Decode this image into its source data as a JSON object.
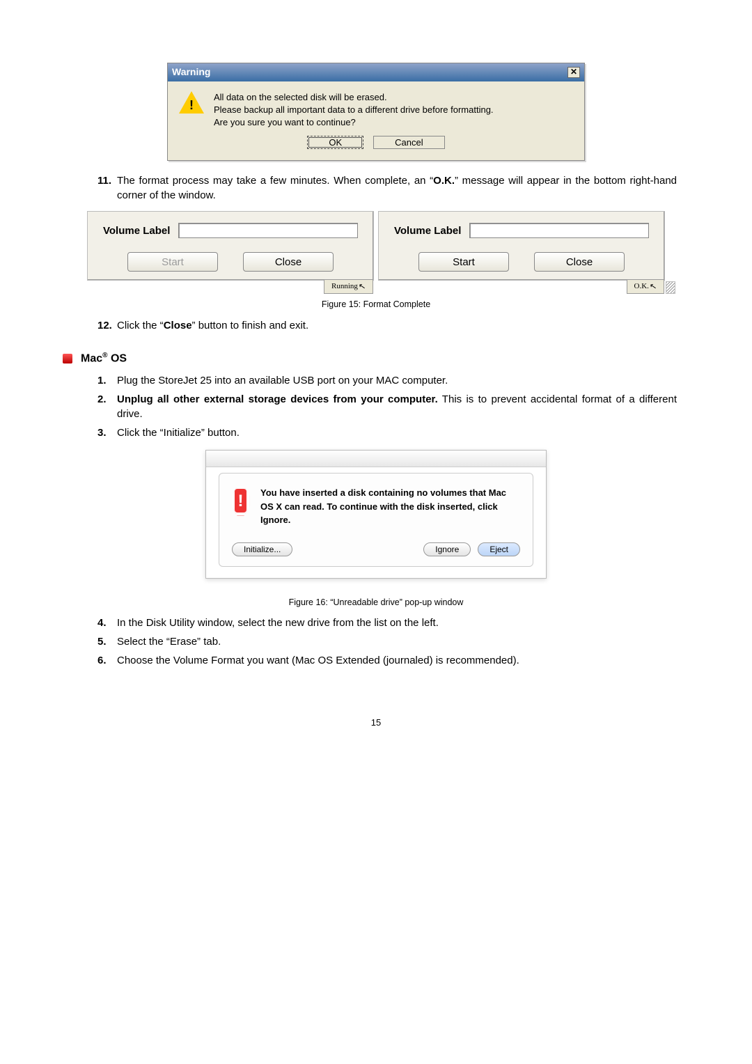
{
  "warning_dialog": {
    "title": "Warning",
    "close_glyph": "✕",
    "line1": "All data on the selected disk will be erased.",
    "line2": "Please backup all important data to a different drive before formatting.",
    "line3": "Are you sure you want to continue?",
    "ok": "OK",
    "cancel": "Cancel"
  },
  "step11": {
    "num": "11.",
    "text_a": "The format process may take a few minutes. When complete, an “",
    "bold": "O.K.",
    "text_b": "” message will appear in the bottom right-hand corner of the window."
  },
  "panels": {
    "volume_label": "Volume Label",
    "start": "Start",
    "close": "Close",
    "running": "Running",
    "ok": "O.K."
  },
  "fig15": "Figure 15: Format Complete",
  "step12": {
    "num": "12.",
    "a": "Click the “",
    "b": "Close",
    "c": "” button to finish and exit."
  },
  "mac_section": "Mac",
  "mac_section_suffix": " OS",
  "mac_steps": {
    "s1": {
      "num": "1.",
      "text": "Plug the StoreJet 25 into an available USB port on your MAC computer."
    },
    "s2": {
      "num": "2.",
      "bold": "Unplug all other external storage devices from your computer.",
      "text": " This is to prevent accidental format of a different drive."
    },
    "s3": {
      "num": "3.",
      "text": "Click the “Initialize” button."
    },
    "s4": {
      "num": "4.",
      "text": "In the Disk Utility window, select the new drive from the list on the left."
    },
    "s5": {
      "num": "5.",
      "text": "Select the “Erase” tab."
    },
    "s6": {
      "num": "6.",
      "text": "Choose the Volume Format you want (Mac OS Extended (journaled) is recommended)."
    }
  },
  "mac_dialog": {
    "msg": "You have inserted a disk containing no volumes that Mac OS X can read.  To continue with the disk inserted, click Ignore.",
    "initialize": "Initialize...",
    "ignore": "Ignore",
    "eject": "Eject"
  },
  "fig16": "Figure 16: “Unreadable drive” pop-up window",
  "page": "15"
}
